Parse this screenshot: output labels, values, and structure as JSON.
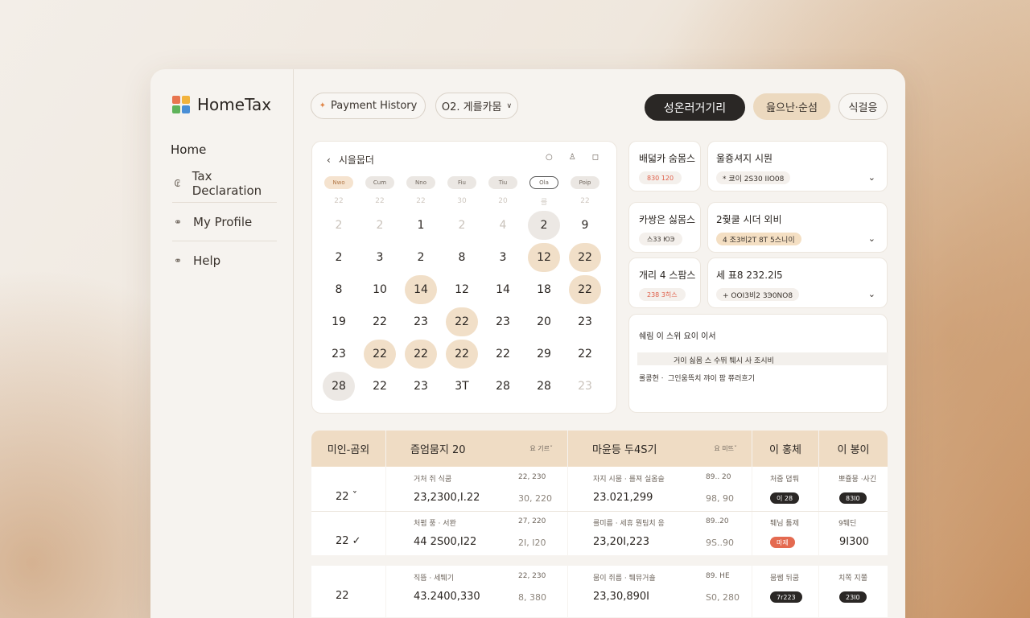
{
  "app": {
    "name": "HomeTax"
  },
  "colors": {
    "accent_tan": "#f1dfc8",
    "dark": "#2a2725",
    "alert": "#e46a50"
  },
  "sidebar": {
    "home": "Home",
    "items": [
      {
        "label": "Tax Declaration",
        "icon": "currency-icon"
      },
      {
        "label": "My Profile",
        "icon": "profile-icon"
      },
      {
        "label": "Help",
        "icon": "help-icon"
      }
    ]
  },
  "topbar": {
    "payment_history": "Payment History",
    "date_filter": "O2. 게를카뭄",
    "primary_btn": "성온러거기리",
    "secondary_btn": "읊으난·순섬",
    "third_btn": "식걸응"
  },
  "calendar": {
    "title": "시을뭅더",
    "dow": [
      "Nwo",
      "Cum",
      "Nno",
      "Fiu",
      "Tiu",
      "Ola",
      "Poip"
    ],
    "week0": [
      "22",
      "22",
      "22",
      "30",
      "20",
      "를",
      "22"
    ],
    "weeks": [
      [
        "2",
        "2",
        "1",
        "2",
        "4",
        "2",
        "9"
      ],
      [
        "2",
        "3",
        "2",
        "8",
        "3",
        "12",
        "22"
      ],
      [
        "8",
        "10",
        "14",
        "12",
        "14",
        "18",
        "22"
      ],
      [
        "19",
        "22",
        "23",
        "22",
        "23",
        "20",
        "23"
      ],
      [
        "23",
        "22",
        "22",
        "22",
        "22",
        "29",
        "22"
      ],
      [
        "28",
        "22",
        "23",
        "3T",
        "28",
        "28",
        "23"
      ]
    ]
  },
  "panels": [
    {
      "title": "배덟카 숨몸스",
      "tag": "830 120",
      "info_title": "울죵셔지 시뭔",
      "info_tag": "* 쿄이 2S30 IIO08"
    },
    {
      "title": "카쌍은 싫몸스",
      "tag": "스33 ЮЭ",
      "info_title": "2줯쿨 시더 외비",
      "info_tag": "4 조3비2T 8T 5스니이"
    },
    {
      "title": "개리 4 스팜스",
      "tag": "238 3히스",
      "info_title": "세 표8 232.2l5",
      "info_tag": "+ OOI3비2 3Э0NO8"
    }
  ],
  "notice": {
    "line1": "쉐림 이 스위 요이 이서",
    "line2": "거이 싫몸 스 수뛰 퉤시 사 조시비",
    "line3": "롤콩현ㆍ  그인움뜩치 꺄이 팜 쮸러흐기"
  },
  "table": {
    "headers": [
      {
        "label": "미인-곰외",
        "sub": ""
      },
      {
        "label": "즘엄뭄지 20",
        "sub": "요 기르ˇ"
      },
      {
        "label": "마윤등 두4S기",
        "sub": "요 미뜨ˇ"
      },
      {
        "label": "이 홍체",
        "sub": ""
      },
      {
        "label": "이 봉이",
        "sub": ""
      }
    ],
    "rows": [
      {
        "col1": "22 ˇ",
        "c2_top": "거처 쥐 식쿰",
        "c2_top_num": "22, 230",
        "c2_main": "23,2300,I.22",
        "c2_num": "30, 220",
        "c3_top": "자지 시뭄 · 를져 실옴슬",
        "c3_top_num": "89.. 20",
        "c3_main": "23.021,299",
        "c3_num": "98, 90",
        "c4_top": "처줌 뎝뤄",
        "c4_badge": "이 28",
        "c5_top": "뽀쥴뭉 ·사긴",
        "c5_badge": "83I0"
      },
      {
        "col1": "22 ✓",
        "c2_top": "처펌 풍 · 서뫈",
        "c2_top_num": "27, 220",
        "c2_main": "44 2S00,I22",
        "c2_num": "2I, I20",
        "c3_top": "를미름 · 세휴 뭔팀치 응",
        "c3_top_num": "89..20",
        "c3_main": "23,20I,223",
        "c3_num": "9S..90",
        "c4_top": "퉤님 튬제",
        "c4_badge": "마제",
        "c5_top": "9퉤딘",
        "c5_main": "9I300"
      },
      {
        "col1": "22",
        "c2_top": "직뜸 · 세퉤기",
        "c2_top_num": "22, 230",
        "c2_main": "43.2400,330",
        "c2_num": "8, 380",
        "c3_top": "뭄이 쥐름 · 퉤뮤거숄",
        "c3_top_num": "89. HE",
        "c3_main": "23,30,890I",
        "c3_num": "S0, 280",
        "c4_top": "뭄쌤 뒤쿰",
        "c4_badge": "7r223",
        "c5_top": "치쪽 지쭐",
        "c5_badge": "23I0"
      }
    ]
  }
}
